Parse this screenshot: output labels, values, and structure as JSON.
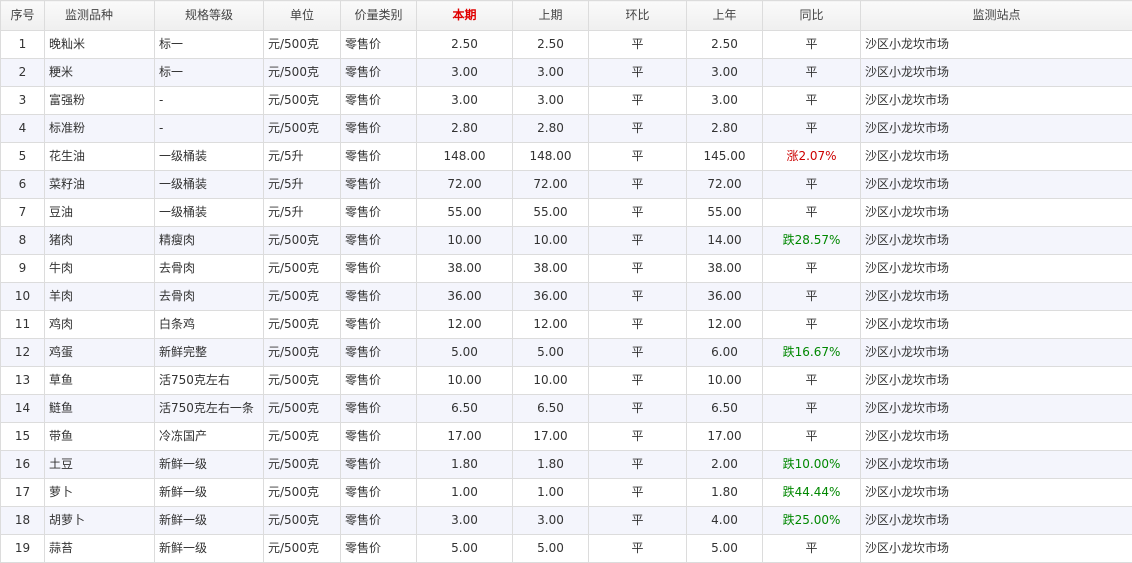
{
  "table": {
    "headers": [
      "序号",
      "监测品种",
      "规格等级",
      "单位",
      "价量类别",
      "本期",
      "上期",
      "环比",
      "上年",
      "同比",
      "监测站点"
    ],
    "rows": [
      {
        "no": "1",
        "name": "晚籼米",
        "spec": "标一",
        "unit": "元/500克",
        "type": "零售价",
        "cur": "2.50",
        "prev": "2.50",
        "mom": "平",
        "lastyear": "2.50",
        "yoy": "平",
        "yoy_dir": "flat",
        "site": "沙区小龙坎市场"
      },
      {
        "no": "2",
        "name": "粳米",
        "spec": "标一",
        "unit": "元/500克",
        "type": "零售价",
        "cur": "3.00",
        "prev": "3.00",
        "mom": "平",
        "lastyear": "3.00",
        "yoy": "平",
        "yoy_dir": "flat",
        "site": "沙区小龙坎市场"
      },
      {
        "no": "3",
        "name": "富强粉",
        "spec": "-",
        "unit": "元/500克",
        "type": "零售价",
        "cur": "3.00",
        "prev": "3.00",
        "mom": "平",
        "lastyear": "3.00",
        "yoy": "平",
        "yoy_dir": "flat",
        "site": "沙区小龙坎市场"
      },
      {
        "no": "4",
        "name": "标准粉",
        "spec": "-",
        "unit": "元/500克",
        "type": "零售价",
        "cur": "2.80",
        "prev": "2.80",
        "mom": "平",
        "lastyear": "2.80",
        "yoy": "平",
        "yoy_dir": "flat",
        "site": "沙区小龙坎市场"
      },
      {
        "no": "5",
        "name": "花生油",
        "spec": "一级桶装",
        "unit": "元/5升",
        "type": "零售价",
        "cur": "148.00",
        "prev": "148.00",
        "mom": "平",
        "lastyear": "145.00",
        "yoy": "涨2.07%",
        "yoy_dir": "up",
        "site": "沙区小龙坎市场"
      },
      {
        "no": "6",
        "name": "菜籽油",
        "spec": "一级桶装",
        "unit": "元/5升",
        "type": "零售价",
        "cur": "72.00",
        "prev": "72.00",
        "mom": "平",
        "lastyear": "72.00",
        "yoy": "平",
        "yoy_dir": "flat",
        "site": "沙区小龙坎市场"
      },
      {
        "no": "7",
        "name": "豆油",
        "spec": "一级桶装",
        "unit": "元/5升",
        "type": "零售价",
        "cur": "55.00",
        "prev": "55.00",
        "mom": "平",
        "lastyear": "55.00",
        "yoy": "平",
        "yoy_dir": "flat",
        "site": "沙区小龙坎市场"
      },
      {
        "no": "8",
        "name": "猪肉",
        "spec": "精瘦肉",
        "unit": "元/500克",
        "type": "零售价",
        "cur": "10.00",
        "prev": "10.00",
        "mom": "平",
        "lastyear": "14.00",
        "yoy": "跌28.57%",
        "yoy_dir": "down",
        "site": "沙区小龙坎市场"
      },
      {
        "no": "9",
        "name": "牛肉",
        "spec": "去骨肉",
        "unit": "元/500克",
        "type": "零售价",
        "cur": "38.00",
        "prev": "38.00",
        "mom": "平",
        "lastyear": "38.00",
        "yoy": "平",
        "yoy_dir": "flat",
        "site": "沙区小龙坎市场"
      },
      {
        "no": "10",
        "name": "羊肉",
        "spec": "去骨肉",
        "unit": "元/500克",
        "type": "零售价",
        "cur": "36.00",
        "prev": "36.00",
        "mom": "平",
        "lastyear": "36.00",
        "yoy": "平",
        "yoy_dir": "flat",
        "site": "沙区小龙坎市场"
      },
      {
        "no": "11",
        "name": "鸡肉",
        "spec": "白条鸡",
        "unit": "元/500克",
        "type": "零售价",
        "cur": "12.00",
        "prev": "12.00",
        "mom": "平",
        "lastyear": "12.00",
        "yoy": "平",
        "yoy_dir": "flat",
        "site": "沙区小龙坎市场"
      },
      {
        "no": "12",
        "name": "鸡蛋",
        "spec": "新鲜完整",
        "unit": "元/500克",
        "type": "零售价",
        "cur": "5.00",
        "prev": "5.00",
        "mom": "平",
        "lastyear": "6.00",
        "yoy": "跌16.67%",
        "yoy_dir": "down",
        "site": "沙区小龙坎市场"
      },
      {
        "no": "13",
        "name": "草鱼",
        "spec": "活750克左右",
        "unit": "元/500克",
        "type": "零售价",
        "cur": "10.00",
        "prev": "10.00",
        "mom": "平",
        "lastyear": "10.00",
        "yoy": "平",
        "yoy_dir": "flat",
        "site": "沙区小龙坎市场"
      },
      {
        "no": "14",
        "name": "鲢鱼",
        "spec": "活750克左右一条",
        "unit": "元/500克",
        "type": "零售价",
        "cur": "6.50",
        "prev": "6.50",
        "mom": "平",
        "lastyear": "6.50",
        "yoy": "平",
        "yoy_dir": "flat",
        "site": "沙区小龙坎市场"
      },
      {
        "no": "15",
        "name": "带鱼",
        "spec": "冷冻国产",
        "unit": "元/500克",
        "type": "零售价",
        "cur": "17.00",
        "prev": "17.00",
        "mom": "平",
        "lastyear": "17.00",
        "yoy": "平",
        "yoy_dir": "flat",
        "site": "沙区小龙坎市场"
      },
      {
        "no": "16",
        "name": "土豆",
        "spec": "新鲜一级",
        "unit": "元/500克",
        "type": "零售价",
        "cur": "1.80",
        "prev": "1.80",
        "mom": "平",
        "lastyear": "2.00",
        "yoy": "跌10.00%",
        "yoy_dir": "down",
        "site": "沙区小龙坎市场"
      },
      {
        "no": "17",
        "name": "萝卜",
        "spec": "新鲜一级",
        "unit": "元/500克",
        "type": "零售价",
        "cur": "1.00",
        "prev": "1.00",
        "mom": "平",
        "lastyear": "1.80",
        "yoy": "跌44.44%",
        "yoy_dir": "down",
        "site": "沙区小龙坎市场"
      },
      {
        "no": "18",
        "name": "胡萝卜",
        "spec": "新鲜一级",
        "unit": "元/500克",
        "type": "零售价",
        "cur": "3.00",
        "prev": "3.00",
        "mom": "平",
        "lastyear": "4.00",
        "yoy": "跌25.00%",
        "yoy_dir": "down",
        "site": "沙区小龙坎市场"
      },
      {
        "no": "19",
        "name": "蒜苔",
        "spec": "新鲜一级",
        "unit": "元/500克",
        "type": "零售价",
        "cur": "5.00",
        "prev": "5.00",
        "mom": "平",
        "lastyear": "5.00",
        "yoy": "平",
        "yoy_dir": "flat",
        "site": "沙区小龙坎市场"
      }
    ]
  },
  "colors": {
    "current_period_header": "#e00000",
    "yoy_up": "#cc0000",
    "yoy_down": "#008800",
    "stripe": "#f4f5fc"
  }
}
